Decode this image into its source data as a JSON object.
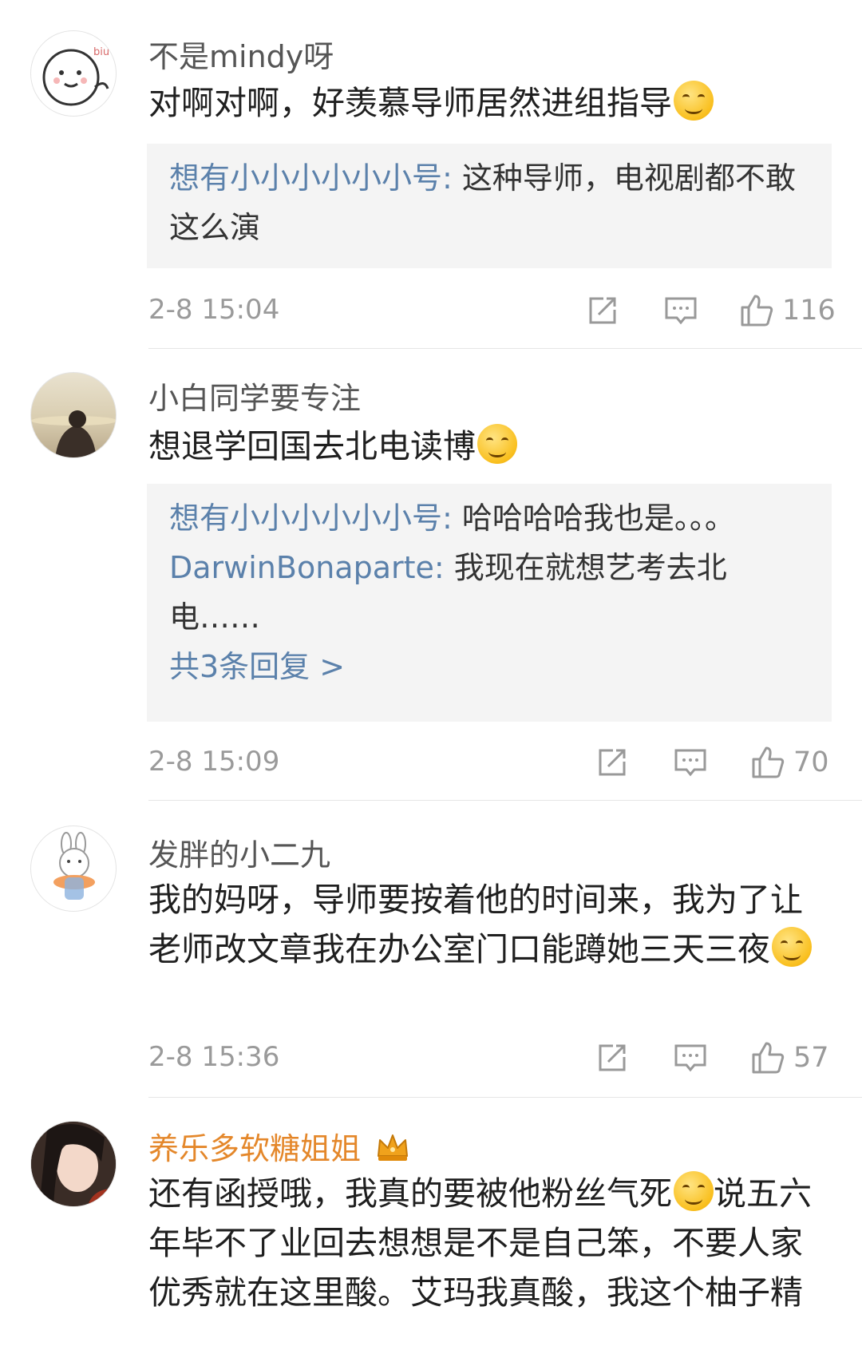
{
  "comments": [
    {
      "username": "不是mindy呀",
      "text": "对啊对啊，好羡慕导师居然进组指导",
      "emoji": "laugh-cry-emoji",
      "replies": [
        {
          "user": "想有小小小小小小号:",
          "text": " 这种导师，电视剧都不敢这么演"
        }
      ],
      "time": "2-8 15:04",
      "likes": "116"
    },
    {
      "username": "小白同学要专注",
      "text": "想退学回国去北电读博",
      "emoji": "upside-down-smile-emoji",
      "replies": [
        {
          "user": "想有小小小小小小号:",
          "text": " 哈哈哈哈我也是。。。"
        },
        {
          "user": "DarwinBonaparte:",
          "text": " 我现在就想艺考去北电……"
        }
      ],
      "more": "共3条回复 >",
      "time": "2-8 15:09",
      "likes": "70"
    },
    {
      "username": "发胖的小二九",
      "text": "我的妈呀，导师要按着他的时间来，我为了让老师改文章我在办公室门口能蹲她三天三夜",
      "emoji": "dizzy-emoji",
      "time": "2-8 15:36",
      "likes": "57"
    },
    {
      "username": "养乐多软糖姐姐",
      "text_a": "还有函授哦，我真的要被他粉丝气死",
      "text_b": "说五六年毕不了业回去想想是不是自己笨，不要人家优秀就在这里酸。艾玛我真酸，我这个柚子精",
      "emoji": "grin-emoji",
      "badge": "crown-icon"
    }
  ],
  "icons": {
    "share": "share-icon",
    "comment": "comment-icon",
    "like": "thumbs-up-icon"
  },
  "colors": {
    "link": "#5b81ab",
    "gold_username": "#e4872a",
    "meta": "#9a9a9a",
    "reply_bg": "#f4f4f4"
  }
}
